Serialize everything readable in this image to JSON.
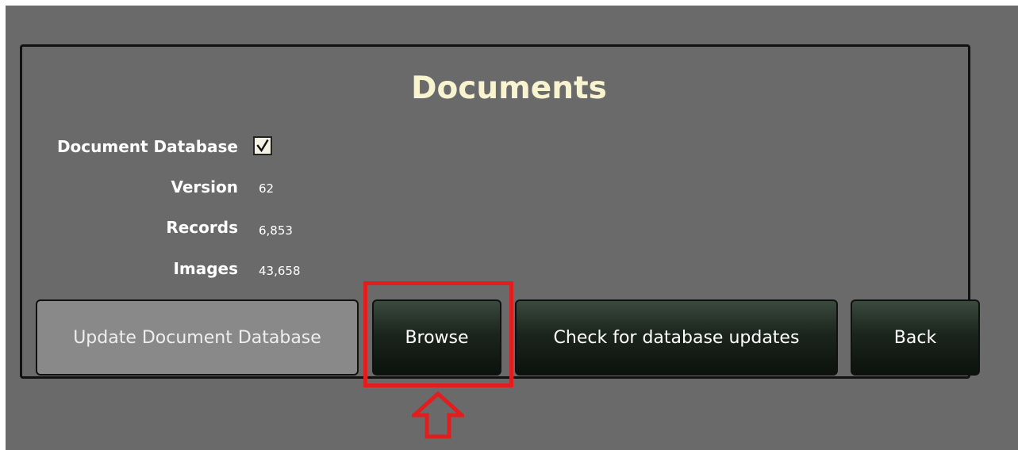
{
  "header": {
    "title": "Documents"
  },
  "info": {
    "document_database_label": "Document Database",
    "document_database_checked": true,
    "version_label": "Version",
    "version_value": "62",
    "records_label": "Records",
    "records_value": "6,853",
    "images_label": "Images",
    "images_value": "43,658"
  },
  "buttons": {
    "update_label": "Update Document Database",
    "browse_label": "Browse",
    "check_updates_label": "Check for database updates",
    "back_label": "Back"
  },
  "annotation": {
    "highlight_color": "#e11d1d",
    "arrow_icon": "arrow-up-icon"
  },
  "colors": {
    "background": "#6a6a6a",
    "title": "#f8f4d0",
    "button_dark": "#121a14",
    "button_disabled": "#898989"
  }
}
